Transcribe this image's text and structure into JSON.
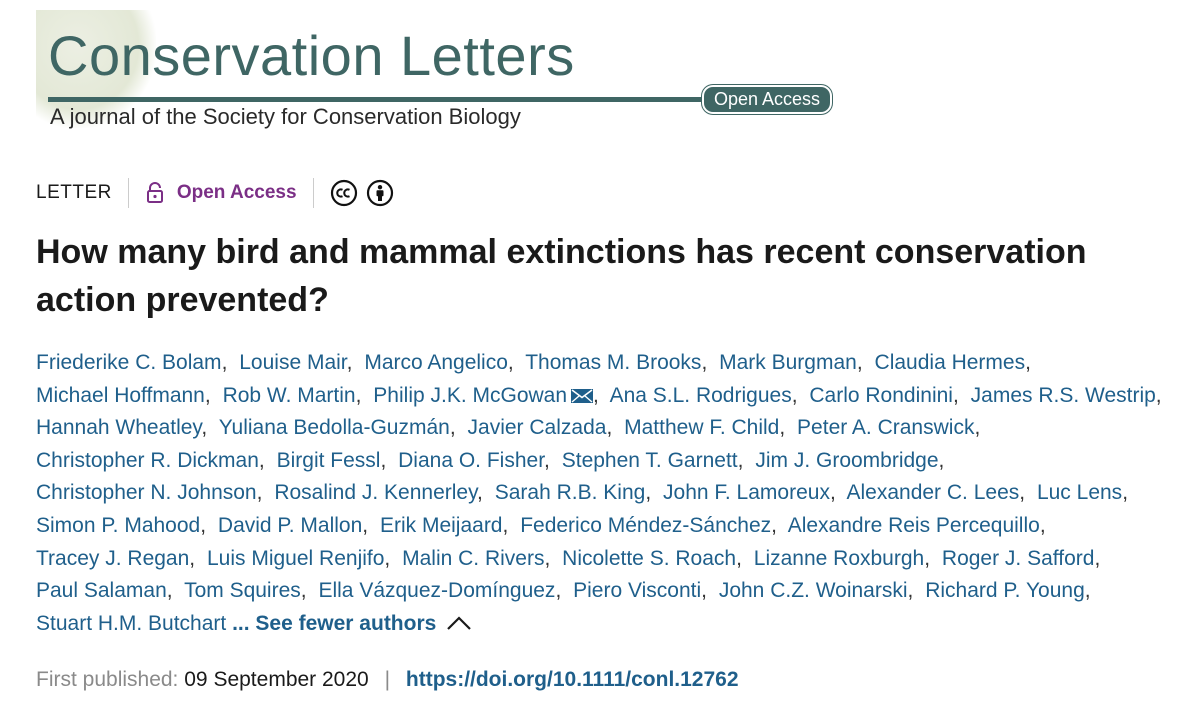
{
  "journal": {
    "title": "Conservation Letters",
    "badge": "Open Access",
    "subtitle": "A journal of the Society for Conservation Biology",
    "brand_color": "#3f6664"
  },
  "meta": {
    "article_type": "LETTER",
    "access_label": "Open Access",
    "access_color": "#7b2f86",
    "license_icons": [
      "cc-icon",
      "attribution-icon"
    ]
  },
  "article": {
    "title": "How many bird and mammal extinctions has recent conservation action prevented?"
  },
  "authors": [
    "Friederike C. Bolam",
    "Louise Mair",
    "Marco Angelico",
    "Thomas M. Brooks",
    "Mark Burgman",
    "Claudia Hermes",
    "Michael Hoffmann",
    "Rob W. Martin",
    "Philip J.K. McGowan",
    "Ana S.L. Rodrigues",
    "Carlo Rondinini",
    "James R.S. Westrip",
    "Hannah Wheatley",
    "Yuliana Bedolla-Guzmán",
    "Javier Calzada",
    "Matthew F. Child",
    "Peter A. Cranswick",
    "Christopher R. Dickman",
    "Birgit Fessl",
    "Diana O. Fisher",
    "Stephen T. Garnett",
    "Jim J. Groombridge",
    "Christopher N. Johnson",
    "Rosalind J. Kennerley",
    "Sarah R.B. King",
    "John F. Lamoreux",
    "Alexander C. Lees",
    "Luc Lens",
    "Simon P. Mahood",
    "David P. Mallon",
    "Erik Meijaard",
    "Federico Méndez-Sánchez",
    "Alexandre Reis Percequillo",
    "Tracey J. Regan",
    "Luis Miguel Renjifo",
    "Malin C. Rivers",
    "Nicolette S. Roach",
    "Lizanne Roxburgh",
    "Roger J. Safford",
    "Paul Salaman",
    "Tom Squires",
    "Ella Vázquez-Domínguez",
    "Piero Visconti",
    "John C.Z. Woinarski",
    "Richard P. Young",
    "Stuart H.M. Butchart"
  ],
  "corresponding_author_index": 8,
  "see_fewer_label": "... See fewer authors",
  "publication": {
    "label": "First published:",
    "date": "09 September 2020",
    "separator": "|",
    "doi": "https://doi.org/10.1111/conl.12762"
  }
}
